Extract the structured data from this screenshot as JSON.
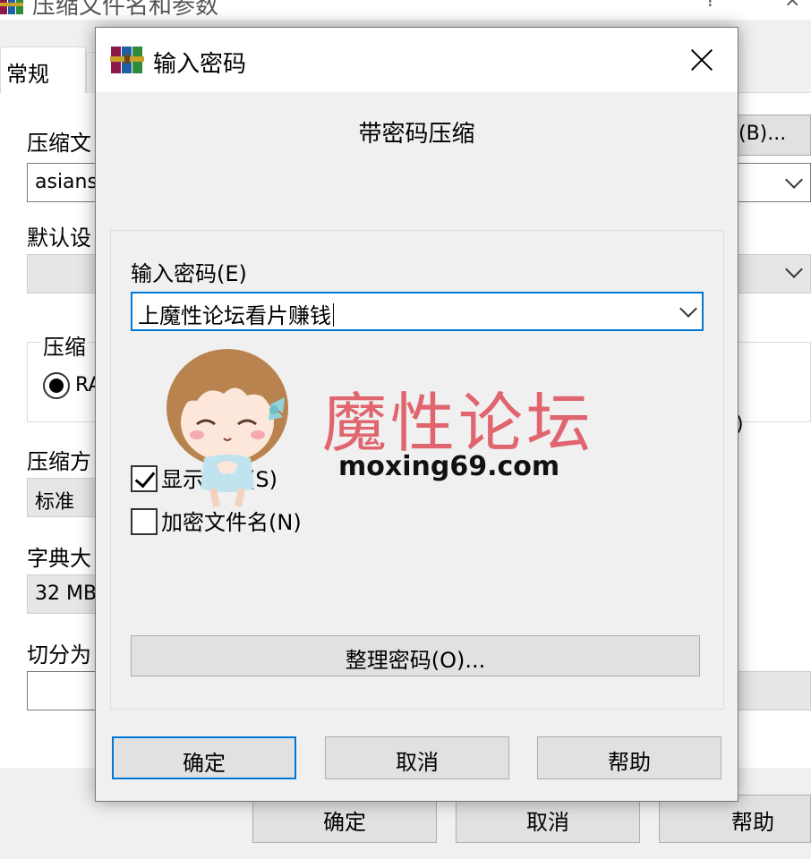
{
  "background_window": {
    "title": "压缩文件名和参数",
    "title_help": "?",
    "title_close": "×",
    "tab_active": "常规",
    "archive_name_label": "压缩文",
    "archive_name_value": "asians",
    "browse_button": "(B)...",
    "default_settings_label": "默认设",
    "format_group_label": "压缩",
    "format_radio_label": "RA",
    "right_paren": ")",
    "method_label": "压缩方",
    "method_value": "标准",
    "dictionary_label": "字典大",
    "dictionary_value": "32 MB",
    "split_label": "切分为",
    "buttons": {
      "ok": "确定",
      "cancel": "取消",
      "help": "帮助"
    }
  },
  "dialog": {
    "title": "输入密码",
    "heading": "带密码压缩",
    "password_label": "输入密码(E)",
    "password_value": "上魔性论坛看片赚钱",
    "show_password_label": "显示密码(S)",
    "show_password_checked": true,
    "encrypt_filenames_label": "加密文件名(N)",
    "encrypt_filenames_checked": false,
    "organize_button": "整理密码(O)...",
    "buttons": {
      "ok": "确定",
      "cancel": "取消",
      "help": "帮助"
    }
  },
  "watermark": {
    "text": "魔性论坛",
    "url": "moxing69.com"
  },
  "colors": {
    "focus_blue": "#0078d7",
    "watermark_pink": "#e0656e"
  }
}
